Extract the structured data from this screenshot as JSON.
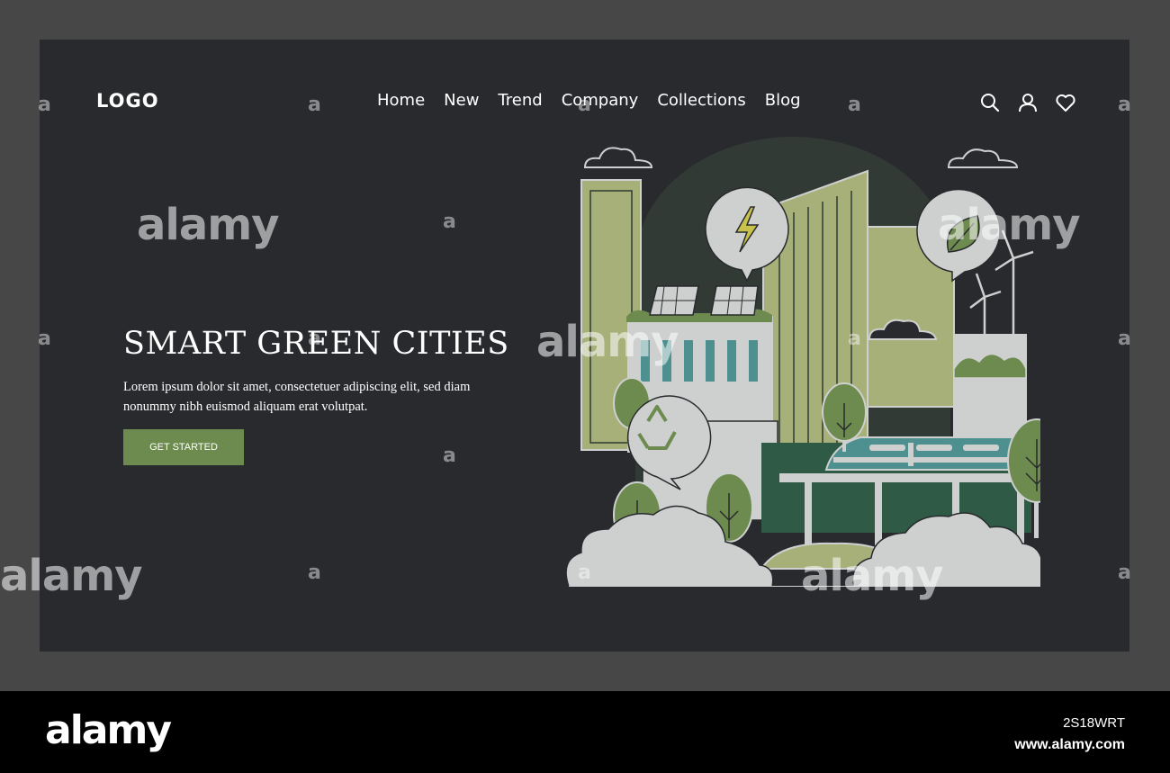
{
  "header": {
    "logo": "LOGO",
    "nav": [
      "Home",
      "New",
      "Trend",
      "Company",
      "Collections",
      "Blog"
    ],
    "icons": [
      "search-icon",
      "user-icon",
      "heart-icon"
    ]
  },
  "hero": {
    "title": "SMART GREEN CITIES",
    "body": "Lorem ipsum dolor sit amet, consectetuer adipiscing elit, sed diam nonummy nibh euismod aliquam erat volutpat.",
    "cta_label": "GET STARTED"
  },
  "illustration": {
    "icons": [
      "lightning-icon",
      "leaf-icon",
      "recycle-icon"
    ]
  },
  "watermark": {
    "brand": "alamy",
    "letter": "a"
  },
  "footer": {
    "brand": "alamy",
    "image_id": "2S18WRT",
    "url": "www.alamy.com"
  },
  "colors": {
    "background": "#474747",
    "frame": "#292a2e",
    "accent_green": "#6d8b4f",
    "olive": "#a8b07a",
    "dark_green": "#2f5a45",
    "light_gray": "#cdd0cf",
    "teal": "#4e8f8f"
  }
}
